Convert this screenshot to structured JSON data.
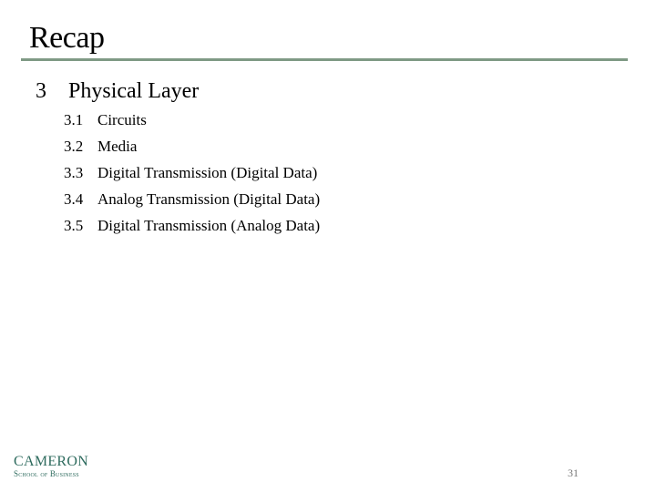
{
  "slide": {
    "title": "Recap",
    "section": {
      "number": "3",
      "label": "Physical Layer"
    },
    "items": [
      {
        "number": "3.1",
        "label": "Circuits"
      },
      {
        "number": "3.2",
        "label": "Media"
      },
      {
        "number": "3.3",
        "label": "Digital Transmission (Digital Data)"
      },
      {
        "number": "3.4",
        "label": "Analog Transmission (Digital Data)"
      },
      {
        "number": "3.5",
        "label": "Digital Transmission (Analog Data)"
      }
    ],
    "page_number": "31",
    "accent_color": "#7f9a85"
  },
  "logo": {
    "name": "CAMERON",
    "subtitle": "School of Business"
  }
}
